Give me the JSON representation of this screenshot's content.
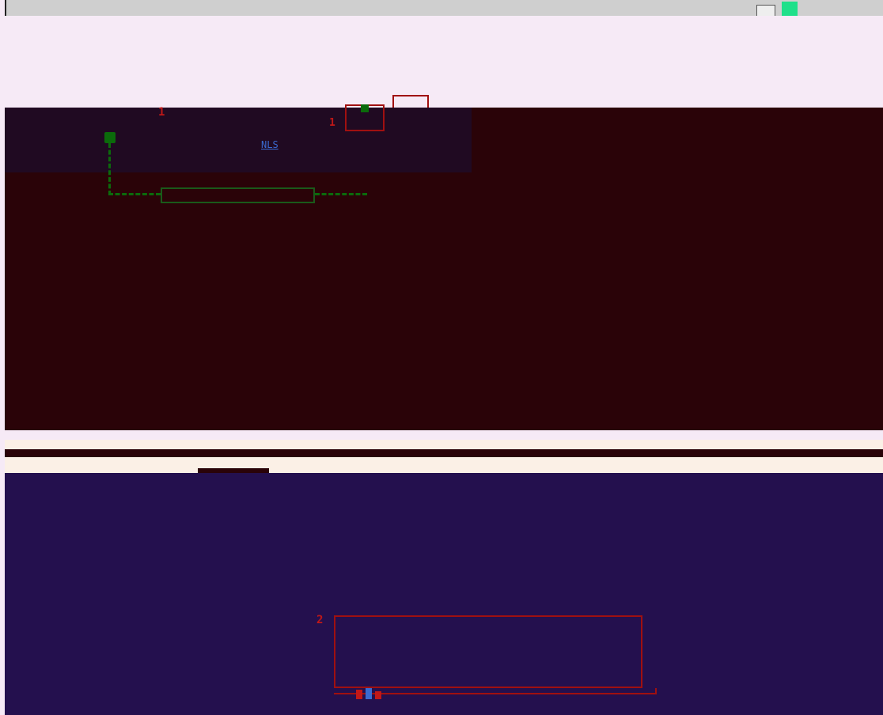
{
  "colors": {
    "window_chrome": "#cfcfcf",
    "toolbar_bg": "#f6eaf6",
    "top_panel_bg": "#2a0308",
    "top_subpanel_bg": "#200a22",
    "status_bar_bg": "#fbf0e6",
    "bottom_panel_bg": "#24104e",
    "callout_red": "#a01010",
    "connector_green": "#0b6b0b",
    "marker_red": "#c01818",
    "link_blue": "#3a6ad0",
    "tray_accent": "#1fe08a"
  },
  "top_panel": {
    "marker_1": "1",
    "marker_red_1": "1",
    "link_text": "NLS"
  },
  "bottom_panel": {
    "marker_2": "2"
  },
  "icons": {
    "tray": "display-icon",
    "tray_accent": "app-icon",
    "bottom": "cursor-icon"
  }
}
